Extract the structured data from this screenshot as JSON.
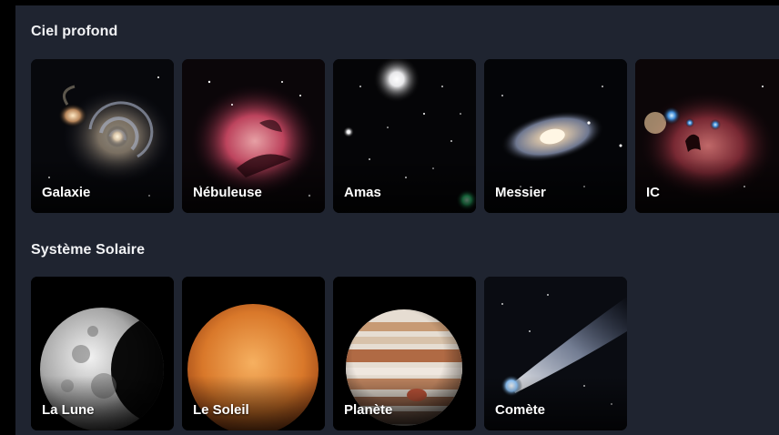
{
  "sections": [
    {
      "title": "Ciel profond",
      "items": [
        {
          "label": "Galaxie",
          "icon": "spiral-galaxy-image"
        },
        {
          "label": "Nébuleuse",
          "icon": "nebula-image"
        },
        {
          "label": "Amas",
          "icon": "star-cluster-image"
        },
        {
          "label": "Messier",
          "icon": "messier-galaxy-image"
        },
        {
          "label": "IC",
          "icon": "horsehead-nebula-image"
        }
      ]
    },
    {
      "title": "Système Solaire",
      "items": [
        {
          "label": "La Lune",
          "icon": "moon-image"
        },
        {
          "label": "Le Soleil",
          "icon": "sun-image"
        },
        {
          "label": "Planète",
          "icon": "jupiter-image"
        },
        {
          "label": "Comète",
          "icon": "comet-image"
        }
      ]
    }
  ]
}
